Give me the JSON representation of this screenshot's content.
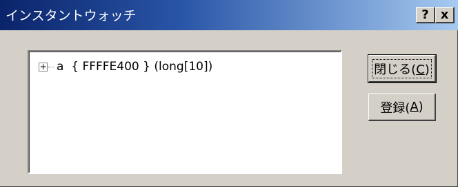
{
  "window": {
    "title": "インスタントウォッチ",
    "help_button": "?",
    "close_button": "x"
  },
  "watch_list": {
    "items": [
      {
        "expand_glyph": "+",
        "text": "a  { FFFFE400 } (long[10])"
      }
    ]
  },
  "buttons": {
    "close": {
      "label": "閉じる(",
      "mnemonic": "C",
      "suffix": ")"
    },
    "register": {
      "label": "登録(",
      "mnemonic": "A",
      "suffix": ")"
    }
  }
}
